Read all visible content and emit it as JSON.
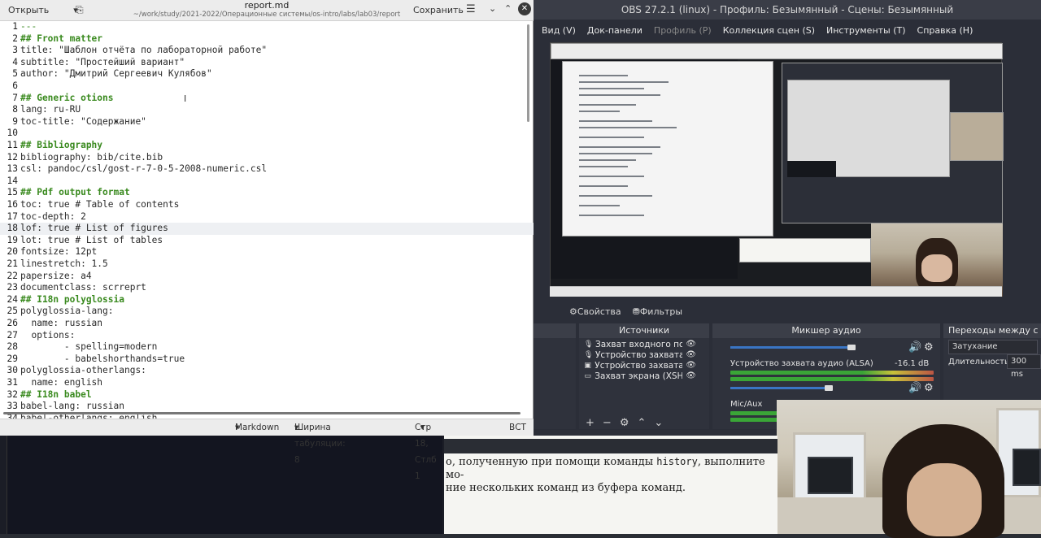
{
  "obs": {
    "title": "OBS 27.2.1 (linux) - Профиль: Безымянный - Сцены: Безымянный",
    "menu": [
      {
        "label": "Вид (V)",
        "dim": false
      },
      {
        "label": "Док-панели",
        "dim": false
      },
      {
        "label": "Профиль (P)",
        "dim": true
      },
      {
        "label": "Коллекция сцен (S)",
        "dim": false
      },
      {
        "label": "Инструменты (T)",
        "dim": false
      },
      {
        "label": "Справка (H)",
        "dim": false
      }
    ],
    "toolbar": {
      "properties": "Свойства",
      "filters": "Фильтры"
    },
    "sources": {
      "header": "Источники",
      "items": [
        {
          "label": "Захват входного пото",
          "icon": "mic-icon"
        },
        {
          "label": "Устройство захвата ау",
          "icon": "mic-icon"
        },
        {
          "label": "Устройство захвата ви",
          "icon": "camera-icon"
        },
        {
          "label": "Захват экрана (XSHM)",
          "icon": "monitor-icon"
        }
      ]
    },
    "mixer": {
      "header": "Микшер аудио",
      "device": "Устройство захвата аудио (ALSA)",
      "device_level": "-16.1 dB",
      "mic": "Mic/Aux"
    },
    "transitions": {
      "header": "Переходы между с",
      "type": "Затухание",
      "duration_label": "Длительность",
      "duration_value": "300 ms"
    }
  },
  "document": {
    "line1_pre": "о, полученную при помощи команды ",
    "line1_code": "history",
    "line1_post": ", выполните мо-",
    "line2": "ние нескольких команд из буфера команд."
  },
  "editor": {
    "open_label": "Открыть",
    "file_name": "report.md",
    "file_path": "~/work/study/2021-2022/Операционные системы/os-intro/labs/lab03/report",
    "save_label": "Сохранить",
    "current_line": 18,
    "lines": [
      {
        "n": "1",
        "t": "---",
        "s": "rule"
      },
      {
        "n": "2",
        "t": "## Front matter",
        "s": "hd"
      },
      {
        "n": "3",
        "t": "title: \"Шаблон отчёта по лабораторной работе\"",
        "s": ""
      },
      {
        "n": "4",
        "t": "subtitle: \"Простейший вариант\"",
        "s": ""
      },
      {
        "n": "5",
        "t": "author: \"Дмитрий Сергеевич Кулябов\"",
        "s": ""
      },
      {
        "n": "6",
        "t": "",
        "s": ""
      },
      {
        "n": "7",
        "t": "## Generic otions",
        "s": "hd"
      },
      {
        "n": "8",
        "t": "lang: ru-RU",
        "s": ""
      },
      {
        "n": "9",
        "t": "toc-title: \"Содержание\"",
        "s": ""
      },
      {
        "n": "10",
        "t": "",
        "s": ""
      },
      {
        "n": "11",
        "t": "## Bibliography",
        "s": "hd"
      },
      {
        "n": "12",
        "t": "bibliography: bib/cite.bib",
        "s": ""
      },
      {
        "n": "13",
        "t": "csl: pandoc/csl/gost-r-7-0-5-2008-numeric.csl",
        "s": ""
      },
      {
        "n": "14",
        "t": "",
        "s": ""
      },
      {
        "n": "15",
        "t": "## Pdf output format",
        "s": "hd"
      },
      {
        "n": "16",
        "t": "toc: true # Table of contents",
        "s": ""
      },
      {
        "n": "17",
        "t": "toc-depth: 2",
        "s": ""
      },
      {
        "n": "18",
        "t": "lof: true # List of figures",
        "s": ""
      },
      {
        "n": "19",
        "t": "lot: true # List of tables",
        "s": ""
      },
      {
        "n": "20",
        "t": "fontsize: 12pt",
        "s": ""
      },
      {
        "n": "21",
        "t": "linestretch: 1.5",
        "s": ""
      },
      {
        "n": "22",
        "t": "papersize: a4",
        "s": ""
      },
      {
        "n": "23",
        "t": "documentclass: scrreprt",
        "s": ""
      },
      {
        "n": "24",
        "t": "## I18n polyglossia",
        "s": "hd"
      },
      {
        "n": "25",
        "t": "polyglossia-lang:",
        "s": ""
      },
      {
        "n": "26",
        "t": "  name: russian",
        "s": ""
      },
      {
        "n": "27",
        "t": "  options:",
        "s": ""
      },
      {
        "n": "28",
        "t": "        - spelling=modern",
        "s": ""
      },
      {
        "n": "29",
        "t": "        - babelshorthands=true",
        "s": ""
      },
      {
        "n": "30",
        "t": "polyglossia-otherlangs:",
        "s": ""
      },
      {
        "n": "31",
        "t": "  name: english",
        "s": ""
      },
      {
        "n": "32",
        "t": "## I18n babel",
        "s": "hd"
      },
      {
        "n": "33",
        "t": "babel-lang: russian",
        "s": ""
      },
      {
        "n": "34",
        "t": "babel-otherlangs: english",
        "s": ""
      }
    ],
    "status": {
      "syntax": "Markdown",
      "tab_width": "Ширина табуляции: 8",
      "position": "Стр 18, Стлб 1",
      "insert_mode": "ВСТ"
    }
  }
}
